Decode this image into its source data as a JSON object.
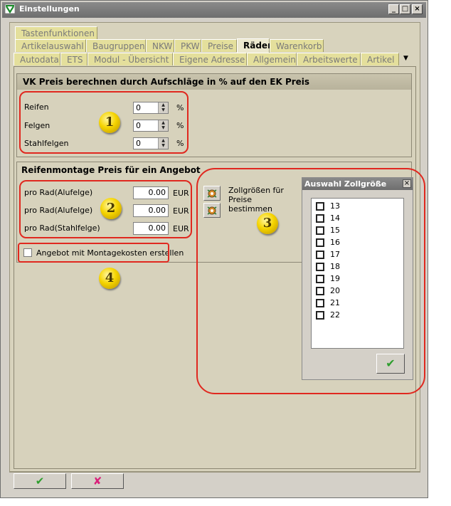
{
  "window": {
    "title": "Einstellungen",
    "minimize": "_",
    "maximize": "□",
    "close": "×"
  },
  "tabs": {
    "row1": [
      "Tastenfunktionen"
    ],
    "row2": [
      "Artikelauswahl",
      "Baugruppen",
      "NKW",
      "PKW",
      "Preise",
      "Räder",
      "Warenkorb"
    ],
    "row3": [
      "Autodata",
      "ETS",
      "Modul - Übersicht",
      "Eigene Adresse",
      "Allgemein",
      "Arbeitswerte",
      "Artikel"
    ],
    "active": "Räder",
    "overflow_arrow": "▼"
  },
  "vk_group": {
    "title": "VK Preis berechnen durch Aufschläge in %  auf den EK Preis",
    "rows": [
      {
        "label": "Reifen",
        "value": "0",
        "unit": "%"
      },
      {
        "label": "Felgen",
        "value": "0",
        "unit": "%"
      },
      {
        "label": "Stahlfelgen",
        "value": "0",
        "unit": "%"
      }
    ]
  },
  "montage_group": {
    "title": "Reifenmontage Preis für ein Angebot",
    "rows": [
      {
        "label": "pro Rad(Alufelge)",
        "value": "0.00",
        "unit": "EUR"
      },
      {
        "label": "pro Rad(Alufelge)",
        "value": "0.00",
        "unit": "EUR"
      },
      {
        "label": "pro Rad(Stahlfelge)",
        "value": "0.00",
        "unit": "EUR"
      }
    ],
    "checkbox_label": "Angebot mit Montagekosten erstellen",
    "checkbox_checked": false
  },
  "zoll": {
    "label": "Zollgrößen für Preise bestimmen"
  },
  "dialog": {
    "title": "Auswahl Zollgröße",
    "close": "×",
    "sizes": [
      "13",
      "14",
      "15",
      "16",
      "17",
      "18",
      "19",
      "20",
      "21",
      "22"
    ],
    "ok_glyph": "✔"
  },
  "badges": [
    "1",
    "2",
    "3",
    "4"
  ],
  "footer": {
    "ok_glyph": "✔",
    "cancel_glyph": "✘"
  },
  "colors": {
    "ok_green": "#2e9e2e",
    "cancel_pink": "#d9207a",
    "highlight_red": "#e0281f",
    "tab_yellow": "#e4df9c"
  }
}
